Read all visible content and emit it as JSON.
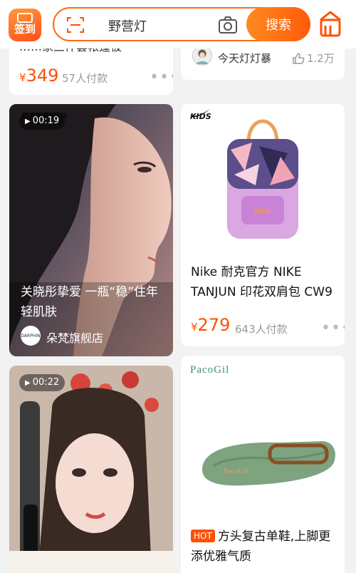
{
  "header": {
    "signin_label": "签到",
    "search_text": "野营灯",
    "search_button": "搜索"
  },
  "cards": {
    "top_left": {
      "partial_title": "……家三件套帐篷被",
      "currency": "¥",
      "price": "349",
      "sold": "57人付款"
    },
    "top_right": {
      "author": "今天灯灯暴",
      "likes": "1.2万"
    },
    "video1": {
      "duration": "00:19",
      "watermark": "DARPHIN",
      "title": "关晓彤挚爱 一瓶“稳”住年轻肌肤",
      "store_logo_text": "DARPHIN",
      "store": "朵梵旗舰店"
    },
    "nike": {
      "brand_text": "KIDS",
      "title": "Nike 耐克官方 NIKE TANJUN 印花双肩包 CW9",
      "currency": "¥",
      "price": "279",
      "sold": "643人付款"
    },
    "video2": {
      "duration": "00:22"
    },
    "shoe": {
      "brand": "PacoGil",
      "hot_badge": "HOT",
      "title": "方头复古单鞋,上脚更添优雅气质"
    }
  }
}
